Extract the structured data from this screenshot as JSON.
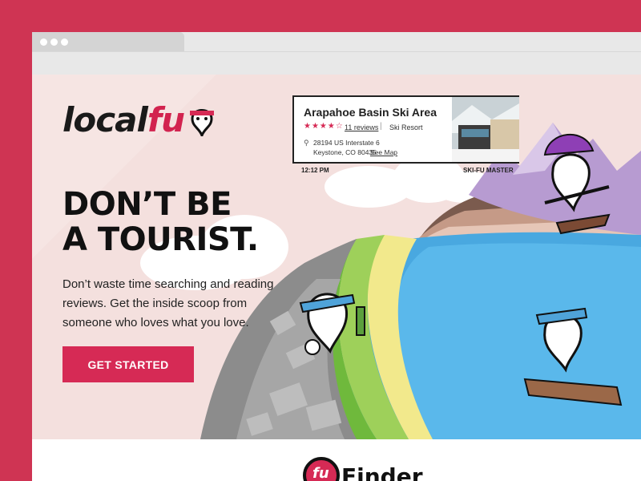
{
  "colors": {
    "brand": "#d62a55",
    "background": "#cf3453",
    "hero_bg": "#f4e0de",
    "text": "#111111"
  },
  "logo": {
    "word_local": "local",
    "word_fu": "fu"
  },
  "hero": {
    "headline_line1": "DON’T BE",
    "headline_line2": "A TOURIST.",
    "subcopy": "Don’t waste time searching and reading reviews. Get the inside scoop from someone who loves what you love.",
    "cta_label": "GET STARTED"
  },
  "card": {
    "name": "Arapahoe Basin Ski Area",
    "rating": 3.5,
    "stars": "★★★★☆",
    "reviews": "11 reviews",
    "separator": "|",
    "category": "Ski Resort",
    "address_line1": "28194 US Interstate 6",
    "address_line2": "Keystone, CO 80435",
    "see_map": "See Map",
    "pin_icon": "pin-icon",
    "time": "12:12 PM",
    "author": "SKI-FU MASTER"
  },
  "lower": {
    "badge": "fu",
    "word": "Finder"
  }
}
